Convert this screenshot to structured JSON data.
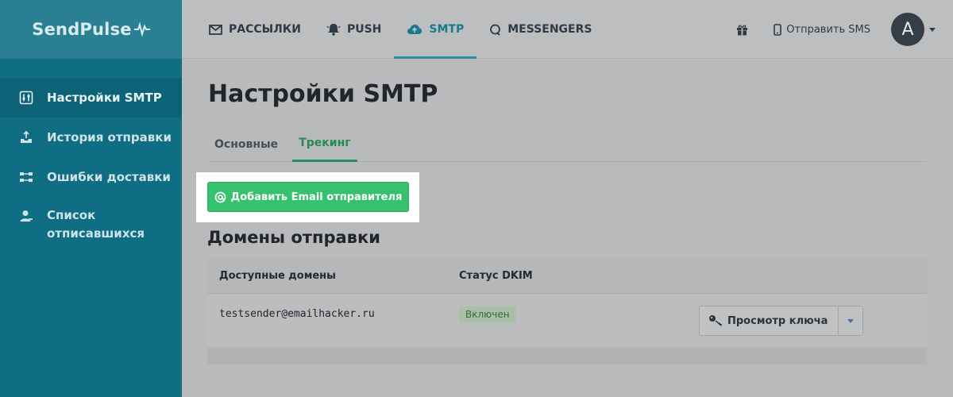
{
  "brand": {
    "name": "SendPulse"
  },
  "sidebar": {
    "items": [
      {
        "label": "Настройки SMTP",
        "icon": "settings-sliders-icon",
        "active": true
      },
      {
        "label": "История отправки",
        "icon": "send-history-icon",
        "active": false
      },
      {
        "label": "Ошибки доставки",
        "icon": "delivery-errors-icon",
        "active": false
      },
      {
        "label_line1": "Список",
        "label_line2": "отписавшихся",
        "icon": "unsubscribed-user-icon",
        "active": false
      }
    ]
  },
  "topnav": {
    "items": [
      {
        "label": "РАССЫЛКИ",
        "icon": "envelope-icon",
        "active": false
      },
      {
        "label": "PUSH",
        "icon": "bell-icon",
        "active": false
      },
      {
        "label": "SMTP",
        "icon": "cloud-upload-icon",
        "active": true
      },
      {
        "label": "MESSENGERS",
        "icon": "chat-bubble-icon",
        "active": false
      }
    ],
    "sms_label": "Отправить SMS",
    "avatar_letter": "A"
  },
  "main": {
    "title": "Настройки SMTP",
    "tabs": [
      {
        "label": "Основные",
        "active": false
      },
      {
        "label": "Трекинг",
        "active": true
      }
    ],
    "add_sender_label": "Добавить Email отправителя",
    "section_title": "Домены отправки",
    "table": {
      "columns": [
        "Доступные домены",
        "Статус DKIM"
      ],
      "rows": [
        {
          "domain": "testsender@emailhacker.ru",
          "status": "Включен",
          "action": "Просмотр ключа"
        }
      ]
    }
  },
  "colors": {
    "sidebar": "#0f6e84",
    "accent_green": "#35c16d",
    "active_nav": "#197a8b"
  }
}
